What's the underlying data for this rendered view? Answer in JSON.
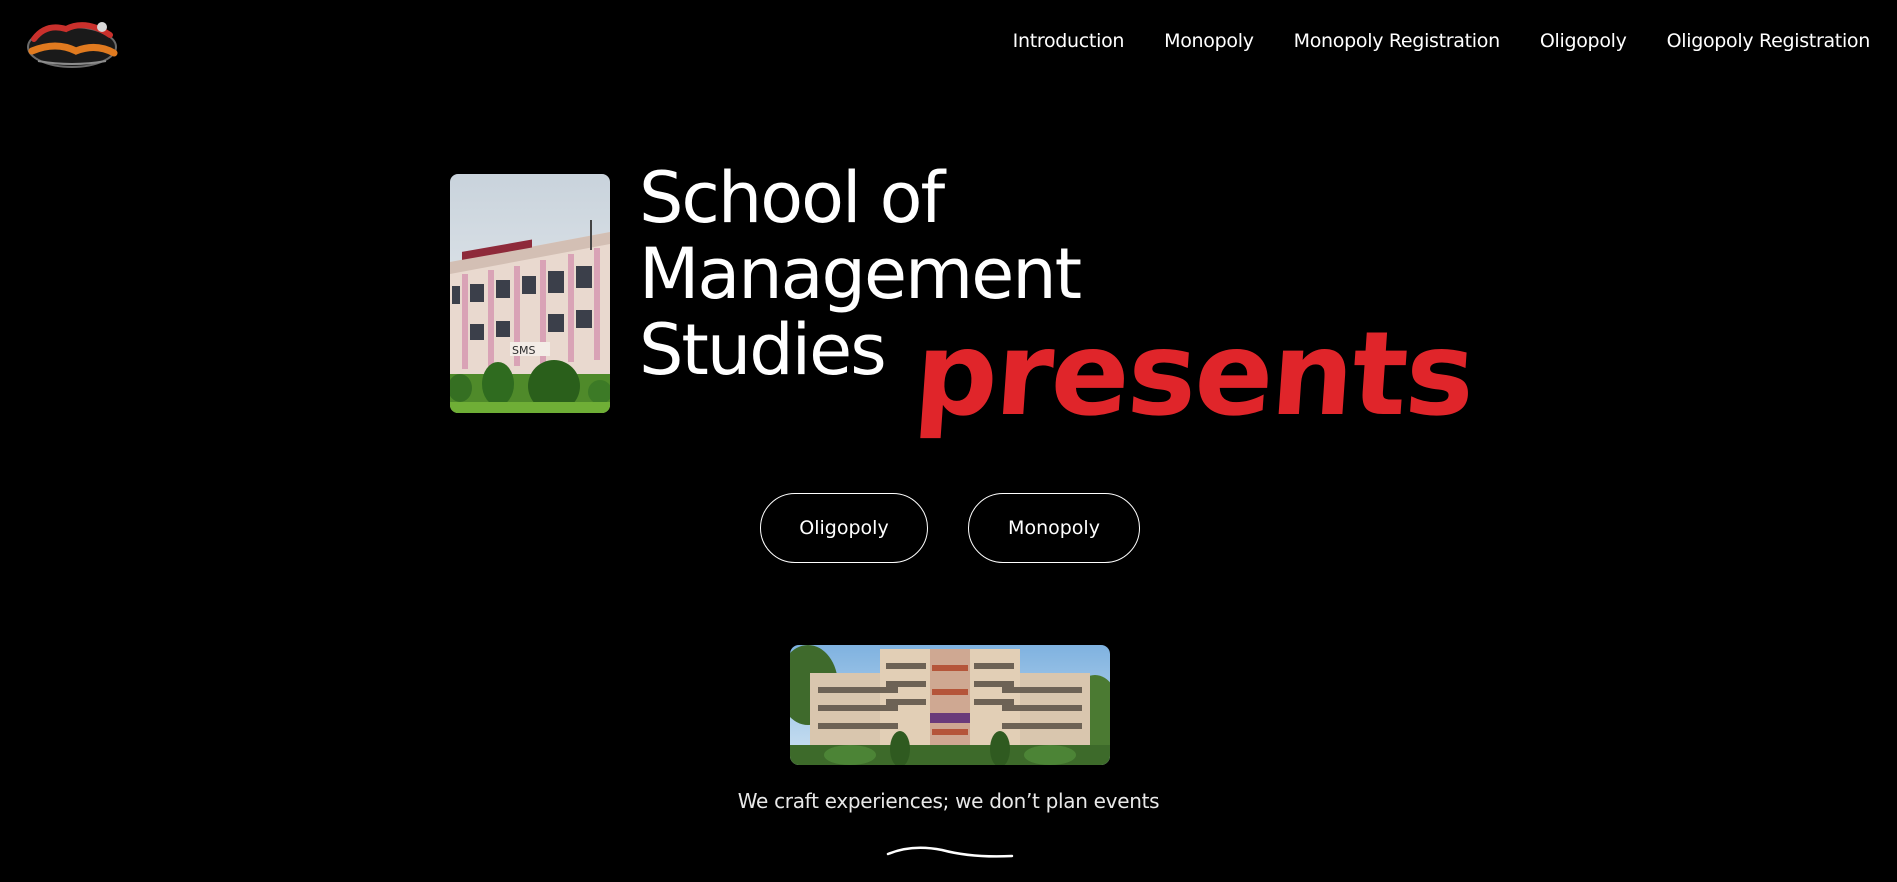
{
  "header": {
    "logo_alt": "Gulzar Avishkar",
    "nav": [
      {
        "label": "Introduction"
      },
      {
        "label": "Monopoly"
      },
      {
        "label": "Monopoly Registration"
      },
      {
        "label": "Oligopoly"
      },
      {
        "label": "Oligopoly Registration"
      }
    ]
  },
  "hero": {
    "title_lines": [
      "School of",
      "Management",
      "Studies"
    ],
    "presents": "presents",
    "presents_color": "#e0252a"
  },
  "buttons": {
    "oligopoly": "Oligopoly",
    "monopoly": "Monopoly"
  },
  "tagline": "We craft experiences; we don’t plan events",
  "images": {
    "hero_photo": "sms-building-photo",
    "campus_photo": "campus-building-photo"
  }
}
